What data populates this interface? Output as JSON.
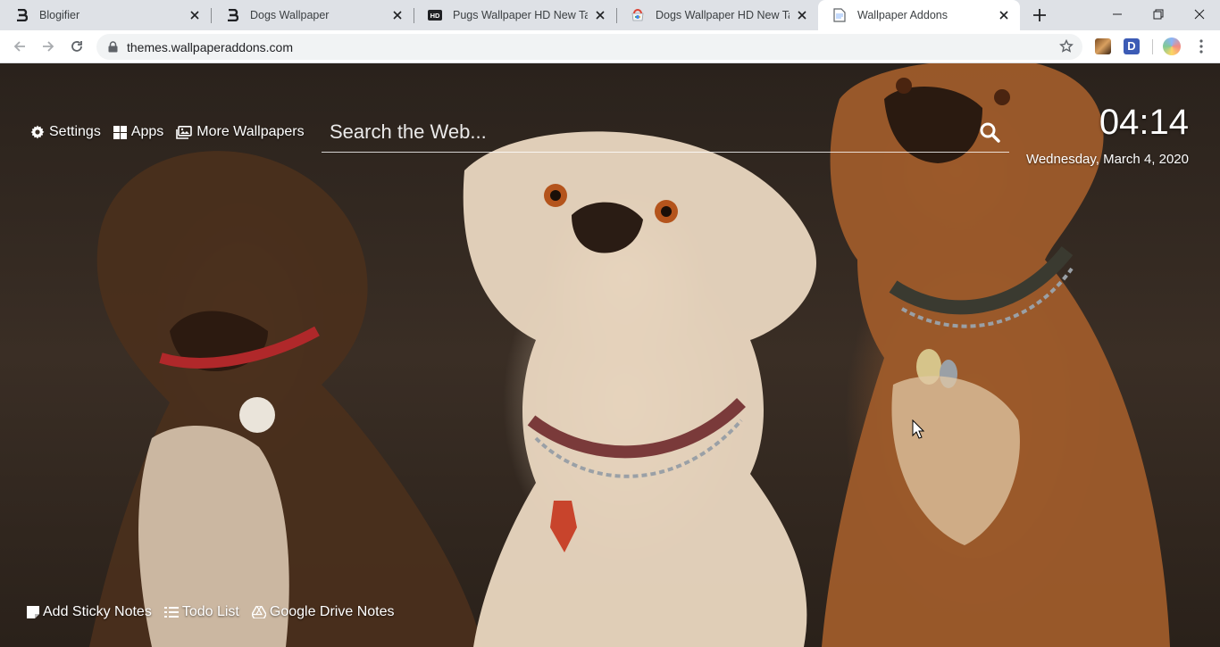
{
  "browser": {
    "tabs": [
      {
        "title": "Blogifier",
        "favicon": "blogifier-b-icon",
        "active": false
      },
      {
        "title": "Dogs Wallpaper",
        "favicon": "blogifier-b-icon",
        "active": false
      },
      {
        "title": "Pugs Wallpaper HD New Tab -",
        "favicon": "hd-icon",
        "active": false
      },
      {
        "title": "Dogs Wallpaper HD New Tab T",
        "favicon": "chrome-store-icon",
        "active": false
      },
      {
        "title": "Wallpaper Addons",
        "favicon": "page-icon",
        "active": true
      }
    ],
    "url": "themes.wallpaperaddons.com",
    "extension_letter": "D",
    "colors": {
      "tabstrip": "#dee1e6",
      "active_tab": "#ffffff",
      "omnibox": "#f1f3f4",
      "accent": "#3c5bb5"
    }
  },
  "page": {
    "top_links": {
      "settings": "Settings",
      "apps": "Apps",
      "more_wallpapers": "More Wallpapers"
    },
    "search": {
      "placeholder": "Search the Web..."
    },
    "clock": {
      "time": "04:14",
      "date": "Wednesday, March 4, 2020"
    },
    "bottom_links": {
      "sticky_notes": "Add Sticky Notes",
      "todo_list": "Todo List",
      "drive_notes": "Google Drive Notes"
    }
  }
}
